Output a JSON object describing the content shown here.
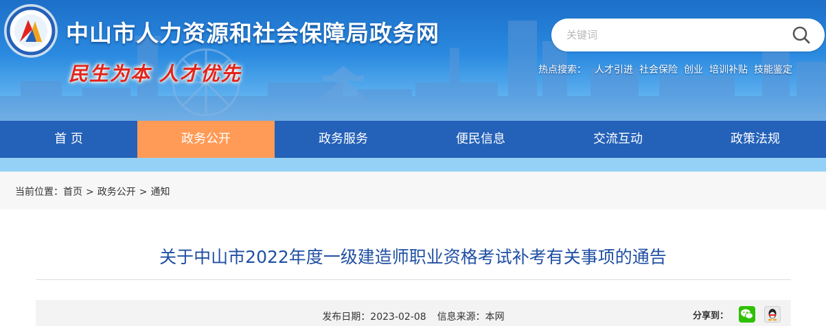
{
  "header": {
    "site_title": "中山市人力资源和社会保障局政务网",
    "slogan": "民生为本 人才优先",
    "search": {
      "placeholder": "关键词"
    },
    "hot_search": {
      "label": "热点搜索：",
      "items": [
        "人才引进",
        "社会保险",
        "创业",
        "培训补贴",
        "技能鉴定"
      ]
    }
  },
  "nav": {
    "items": [
      {
        "label": "首 页"
      },
      {
        "label": "政务公开"
      },
      {
        "label": "政务服务"
      },
      {
        "label": "便民信息"
      },
      {
        "label": "交流互动"
      },
      {
        "label": "政策法规"
      }
    ],
    "active": "政务公开"
  },
  "breadcrumb": {
    "prefix": "当前位置：",
    "items": [
      "首页",
      "政务公开",
      "通知"
    ],
    "separator": ">"
  },
  "article": {
    "title": "关于中山市2022年度一级建造师职业资格考试补考有关事项的通告",
    "publish_date": "发布日期：2023-02-08",
    "source": "信息来源：本网",
    "share_label": "分享到："
  },
  "colors": {
    "nav_bg": "#2461b8",
    "nav_active": "#ff9b57",
    "title_blue": "#1f4fa3",
    "slogan_red": "#e4231b",
    "wechat_green": "#2ec100"
  },
  "icons": [
    "site-logo-icon",
    "search-icon",
    "wechat-icon",
    "qq-icon"
  ]
}
